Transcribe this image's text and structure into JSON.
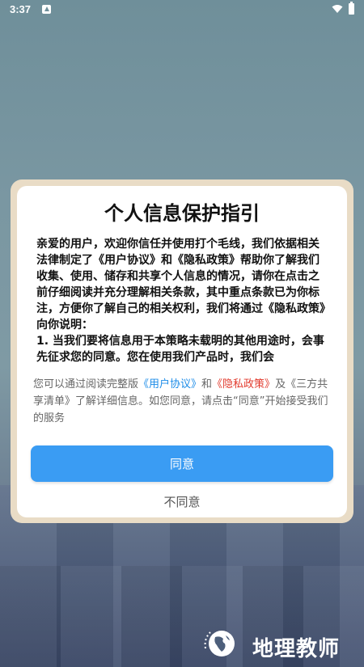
{
  "status_bar": {
    "time": "3:37",
    "notification_icon": "app-notification-icon",
    "wifi_icon": "wifi-icon",
    "battery_icon": "battery-icon"
  },
  "dialog": {
    "title": "个人信息保护指引",
    "body": "亲爱的用户，欢迎你信任并使用打个毛线，我们依据相关法律制定了《用户协议》和《隐私政策》帮助你了解我们收集、使用、储存和共享个人信息的情况，请你在点击之前仔细阅读并充分理解相关条款，其中重点条款已为你标注，方便你了解自己的相关权利，我们将通过《隐私政策》向你说明：",
    "body_item_1": "1. 当我们要将信息用于本策略未载明的其他用途时，会事先征求您的同意。您在使用我们产品时，我们会",
    "footer_prefix": "您可以通过阅读完整版",
    "footer_link_user_agreement": "《用户协议》",
    "footer_and": "和",
    "footer_link_privacy_policy": "《隐私政策》",
    "footer_suffix": "及《三方共享清单》了解详细信息。如您同意，请点击“同意”开始接受我们的服务",
    "agree_label": "同意",
    "disagree_label": "不同意"
  },
  "colors": {
    "primary_button": "#3a9cf3",
    "link_blue": "#1c8ce8",
    "link_red": "#e23b2e",
    "dialog_frame": "#e9dcc6"
  },
  "watermark": {
    "text": "地理教师",
    "logo_icon": "globe-logo-icon"
  }
}
